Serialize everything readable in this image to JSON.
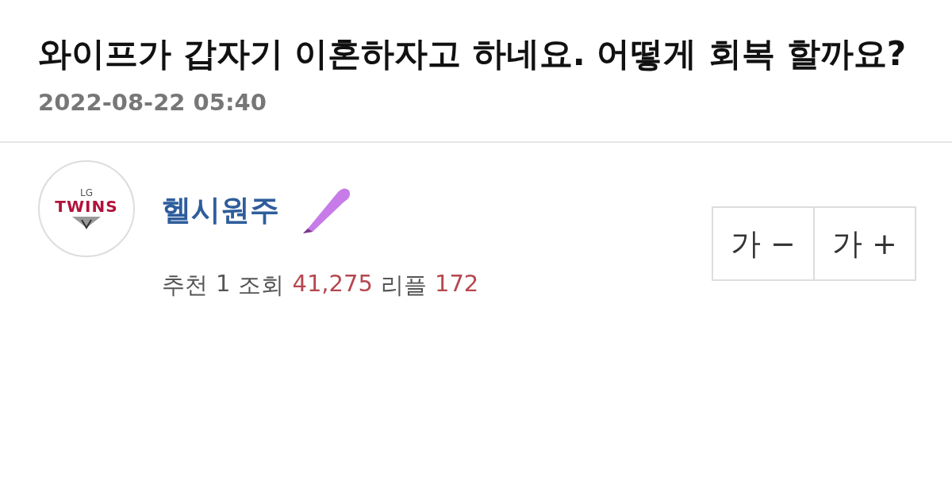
{
  "post": {
    "title": "와이프가 갑자기 이혼하자고 하네요. 어떻게 회복 할까요?",
    "date": "2022-08-22 05:40"
  },
  "author": {
    "avatar": {
      "small": "LG",
      "big": "TWINS"
    },
    "name": "헬시원주"
  },
  "stats": [
    {
      "label": "추천",
      "value": "1",
      "highlight": false
    },
    {
      "label": "조회",
      "value": "41,275",
      "highlight": true
    },
    {
      "label": "리플",
      "value": "172",
      "highlight": true
    }
  ],
  "font_buttons": [
    "가 −",
    "가 +"
  ]
}
